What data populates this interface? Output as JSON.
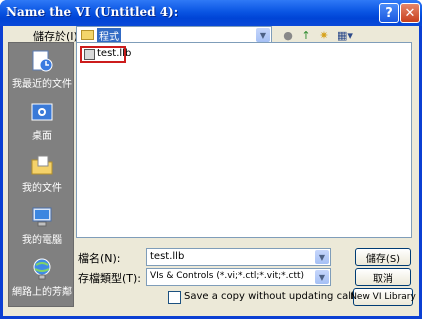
{
  "window": {
    "title": "Name the VI (Untitled 4):"
  },
  "titlebar": {
    "help": "?",
    "close": "✕"
  },
  "save_in": {
    "label": "儲存於(I):",
    "value": "程式",
    "arrow": "▼"
  },
  "toolbar": {
    "back": "●",
    "up": "↑",
    "new_folder": "✷",
    "view_menu": "▦▾"
  },
  "places": [
    {
      "label": "我最近的文件",
      "icon": "recent-documents-icon"
    },
    {
      "label": "桌面",
      "icon": "desktop-icon"
    },
    {
      "label": "我的文件",
      "icon": "my-documents-icon"
    },
    {
      "label": "我的電腦",
      "icon": "my-computer-icon"
    },
    {
      "label": "網路上的芳鄰",
      "icon": "network-places-icon"
    }
  ],
  "files": [
    {
      "name": "test.llb",
      "icon": "llb-file-icon"
    }
  ],
  "filename": {
    "label": "檔名(N):",
    "value": "test.llb"
  },
  "filetype": {
    "label": "存檔類型(T):",
    "value": "VIs & Controls (*.vi;*.ctl;*.vit;*.ctt)"
  },
  "buttons": {
    "save": "儲存(S)",
    "cancel": "取消",
    "new_library": "New VI Library"
  },
  "checkbox": {
    "label": "Save a copy without updating callers.",
    "checked": false
  }
}
